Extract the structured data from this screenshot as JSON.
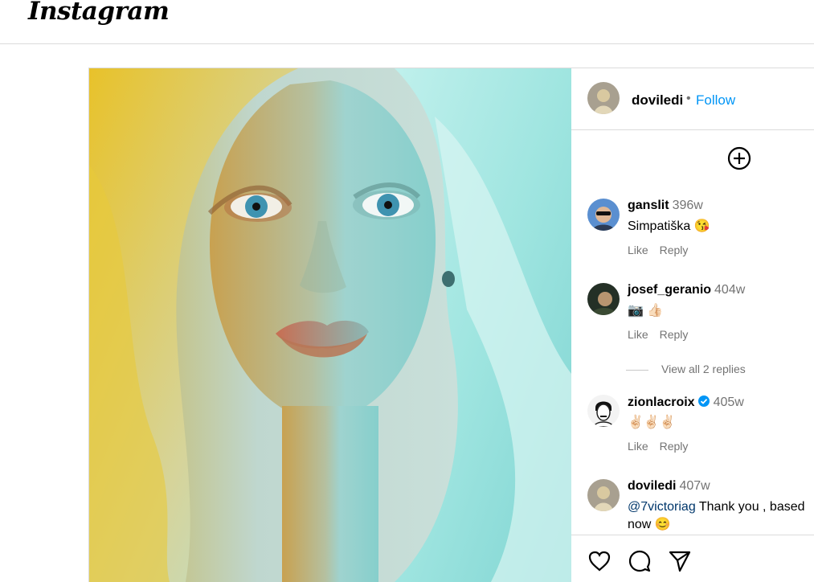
{
  "header": {
    "logo_text": "Instagram"
  },
  "post": {
    "username": "doviledi",
    "separator": "•",
    "follow_label": "Follow",
    "image_subject": "portrait-photo"
  },
  "comments": [
    {
      "username": "ganslit",
      "time": "396w",
      "text": "Simpatiška 😘",
      "like": "Like",
      "reply": "Reply"
    },
    {
      "username": "josef_geranio",
      "time": "404w",
      "text": "📷 👍🏻",
      "like": "Like",
      "reply": "Reply"
    },
    {
      "username": "zionlacroix",
      "time": "405w",
      "text": "✌🏻✌🏻✌🏻",
      "like": "Like",
      "reply": "Reply",
      "verified": true
    },
    {
      "username": "doviledi",
      "time": "407w",
      "mention": "@7victoriag",
      "text": " Thank you , based",
      "text2": "now 😊"
    }
  ],
  "view_replies": "View all 2 replies",
  "icons": {
    "add": "add-comment-icon",
    "like": "heart-icon",
    "comment": "comment-icon",
    "share": "share-icon"
  },
  "colors": {
    "link": "#0095f6",
    "muted": "#737373",
    "border": "#dbdbdb"
  }
}
